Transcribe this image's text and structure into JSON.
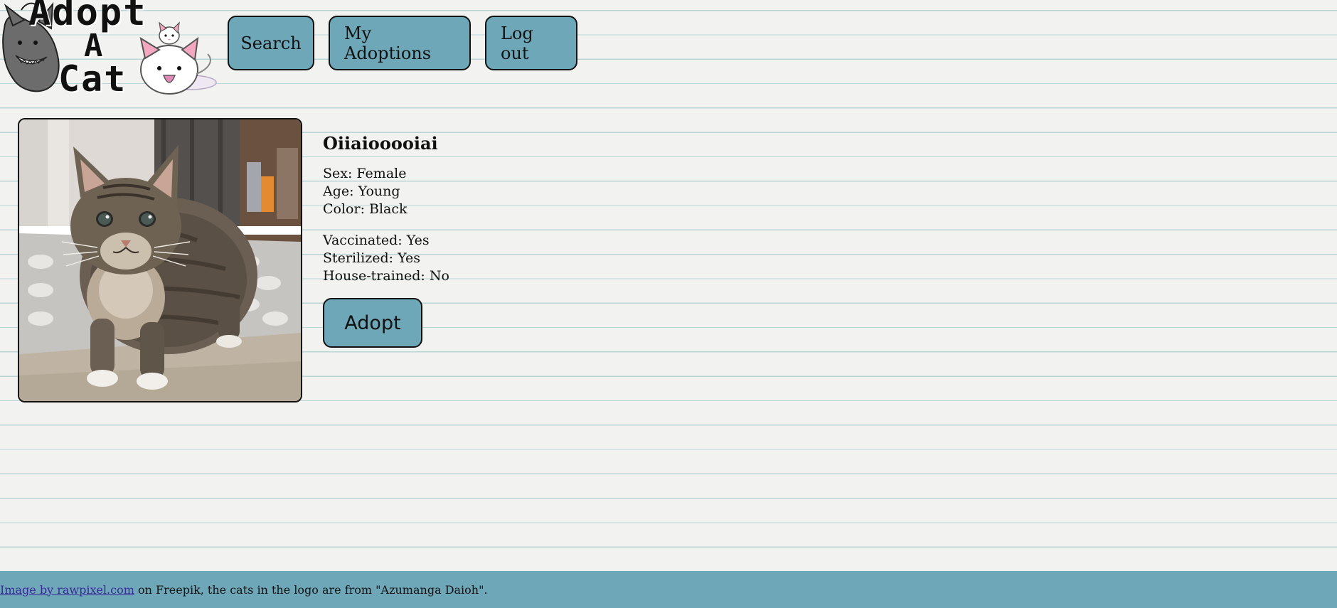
{
  "logo": {
    "line1": "Adopt",
    "line2": "A",
    "line3": "Cat"
  },
  "nav": {
    "search_label": "Search",
    "adoptions_label": "My Adoptions",
    "logout_label": "Log out"
  },
  "cat": {
    "name": "Oiiaiooooiai",
    "sex": "Sex: Female",
    "age": "Age: Young",
    "color": "Color: Black",
    "vaccinated": "Vaccinated: Yes",
    "sterilized": "Sterilized: Yes",
    "house_trained": "House-trained: No",
    "adopt_label": "Adopt"
  },
  "footer": {
    "link_text": "Image by rawpixel.com",
    "rest_text": " on Freepik, the cats in the logo are from \"Azumanga Daioh\"."
  },
  "colors": {
    "accent": "#6ea8b8",
    "page_background": "#f2f3f1",
    "ruled_line": "#b9d4d6",
    "link": "#3a2a9a"
  },
  "icons": {
    "logo_left": "grey-cat-icon",
    "logo_right": "white-cat-icon"
  }
}
